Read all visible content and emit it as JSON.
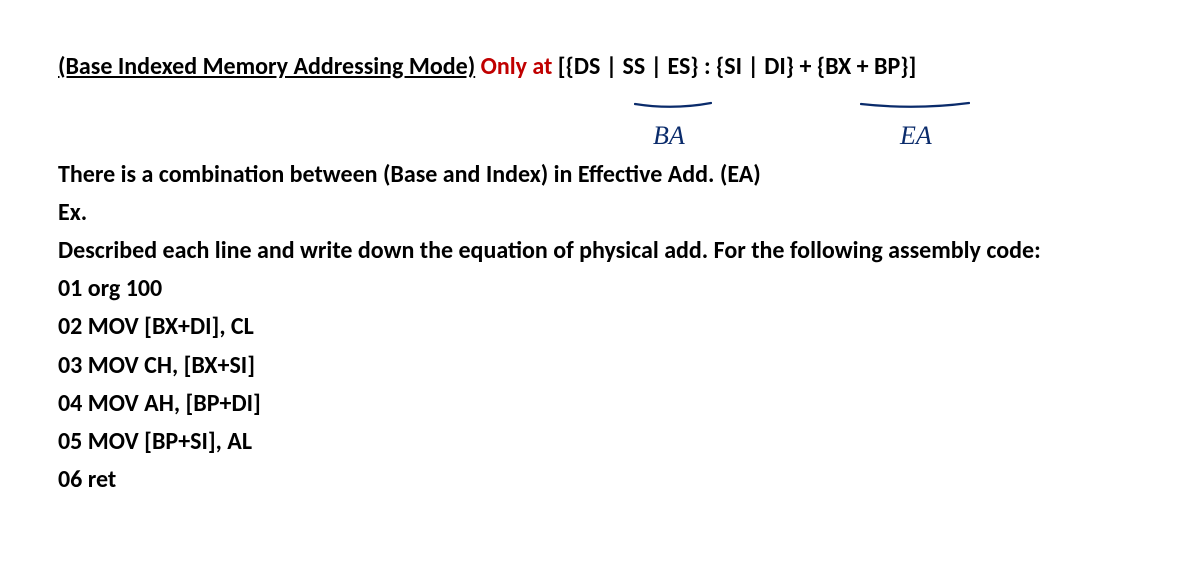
{
  "heading": {
    "title_underlined": "(Base Indexed Memory Addressing Mode)",
    "only_at": " Only at ",
    "lbracket": "[",
    "seg_part": "{DS | SS | ES}",
    "colon_space": " : ",
    "ea_part": "{SI | DI} + {BX + BP}",
    "rbracket": "]"
  },
  "annotations": {
    "ba": "BA",
    "ea": "EA"
  },
  "body": {
    "line1": "There is a combination between (Base and Index) in Effective Add. (EA)",
    "line2": "Ex.",
    "line3": "Described each line and write down the equation of physical add. For the following assembly code:",
    "code1": "01 org 100",
    "code2": "02 MOV [BX+DI], CL",
    "code3": "03 MOV CH, [BX+SI]",
    "code4": "04 MOV AH, [BP+DI]",
    "code5": "05 MOV [BP+SI], AL",
    "code6": "06 ret"
  },
  "colors": {
    "accent_red": "#c00000",
    "ink_blue": "#0a2b6b",
    "text": "#000000"
  }
}
